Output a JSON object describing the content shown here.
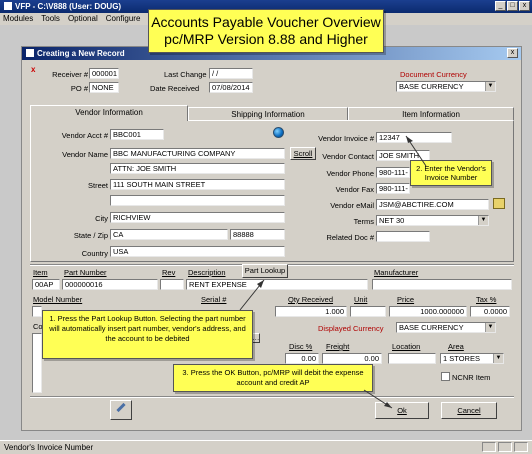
{
  "app": {
    "title": "VFP - C:\\V888 (User: DOUG)",
    "menu": [
      "Modules",
      "Tools",
      "Optional",
      "Configure"
    ]
  },
  "callouts": {
    "title_line1": "Accounts Payable Voucher Overview",
    "title_line2": "pc/MRP Version 8.88 and Higher",
    "step1": "1. Press the Part Lookup Button.  Selecting the part number will automatically insert part number, vendor's address, and the account to be debited",
    "step2": "2. Enter the Vendor's Invoice Number",
    "step3": "3. Press the OK Button, pc/MRP will debit the expense account and credit AP"
  },
  "dialog": {
    "title": "Creating a New Record",
    "receiver_label": "Receiver #",
    "receiver_value": "000001",
    "po_label": "PO #",
    "po_value": "NONE",
    "last_change_label": "Last Change",
    "last_change_value": " / /",
    "date_received_label": "Date Received",
    "date_received_value": "07/08/2014",
    "doc_currency_label": "Document Currency",
    "doc_currency_value": "BASE CURRENCY",
    "tabs": [
      "Vendor Information",
      "Shipping Information",
      "Item Information"
    ],
    "vendor": {
      "acct_label": "Vendor Acct #",
      "acct_value": "BBC001",
      "name_label": "Vendor Name",
      "name_value": "BBC MANUFACTURING COMPANY",
      "attn_value": "ATTN: JOE SMITH",
      "street_label": "Street",
      "street_value": "111 SOUTH MAIN STREET",
      "city_label": "City",
      "city_value": "RICHVIEW",
      "state_zip_label": "State / Zip",
      "state_value": "CA",
      "zip_value": "88888",
      "country_label": "Country",
      "country_value": "USA",
      "scroll_label": "Scroll",
      "invoice_label": "Vendor Invoice #",
      "invoice_value": "12347",
      "contact_label": "Vendor Contact",
      "contact_value": "JOE SMITH",
      "phone_label": "Vendor Phone",
      "phone_value": "980-111-",
      "fax_label": "Vendor Fax",
      "fax_value": "980-111-",
      "email_label": "Vendor eMail",
      "email_value": "JSM@ABCTIRE.COM",
      "terms_label": "Terms",
      "terms_value": "NET 30",
      "related_label": "Related Doc #",
      "related_value": ""
    },
    "item": {
      "item_label": "Item",
      "item_value": "00AP",
      "part_label": "Part Number",
      "part_value": "000000016",
      "rev_label": "Rev",
      "rev_value": "",
      "desc_label": "Description",
      "desc_value": "RENT EXPENSE",
      "part_lookup_label": "Part Lookup",
      "manufacturer_label": "Manufacturer",
      "manufacturer_value": "",
      "model_label": "Model Number",
      "serial_label": "Serial #",
      "qty_label": "Qty Received",
      "qty_value": "1.000",
      "unit_label": "Unit",
      "unit_value": "",
      "price_label": "Price",
      "price_value": "1000.000000",
      "tax_label": "Tax %",
      "tax_value": "0.0000",
      "comments_label": "Comments",
      "displayed_currency_label": "Displayed Currency",
      "displayed_currency_value": "BASE CURRENCY",
      "disc_label": "Disc %",
      "disc_value": "0.00",
      "freight_label": "Freight",
      "freight_value": "0.00",
      "location_label": "Location",
      "location_value": "",
      "area_label": "Area",
      "area_value": "1 STORES",
      "ncnr_label": "NCNR Item"
    },
    "ok_label": "Ok",
    "cancel_label": "Cancel"
  },
  "status_text": "Vendor's Invoice Number"
}
